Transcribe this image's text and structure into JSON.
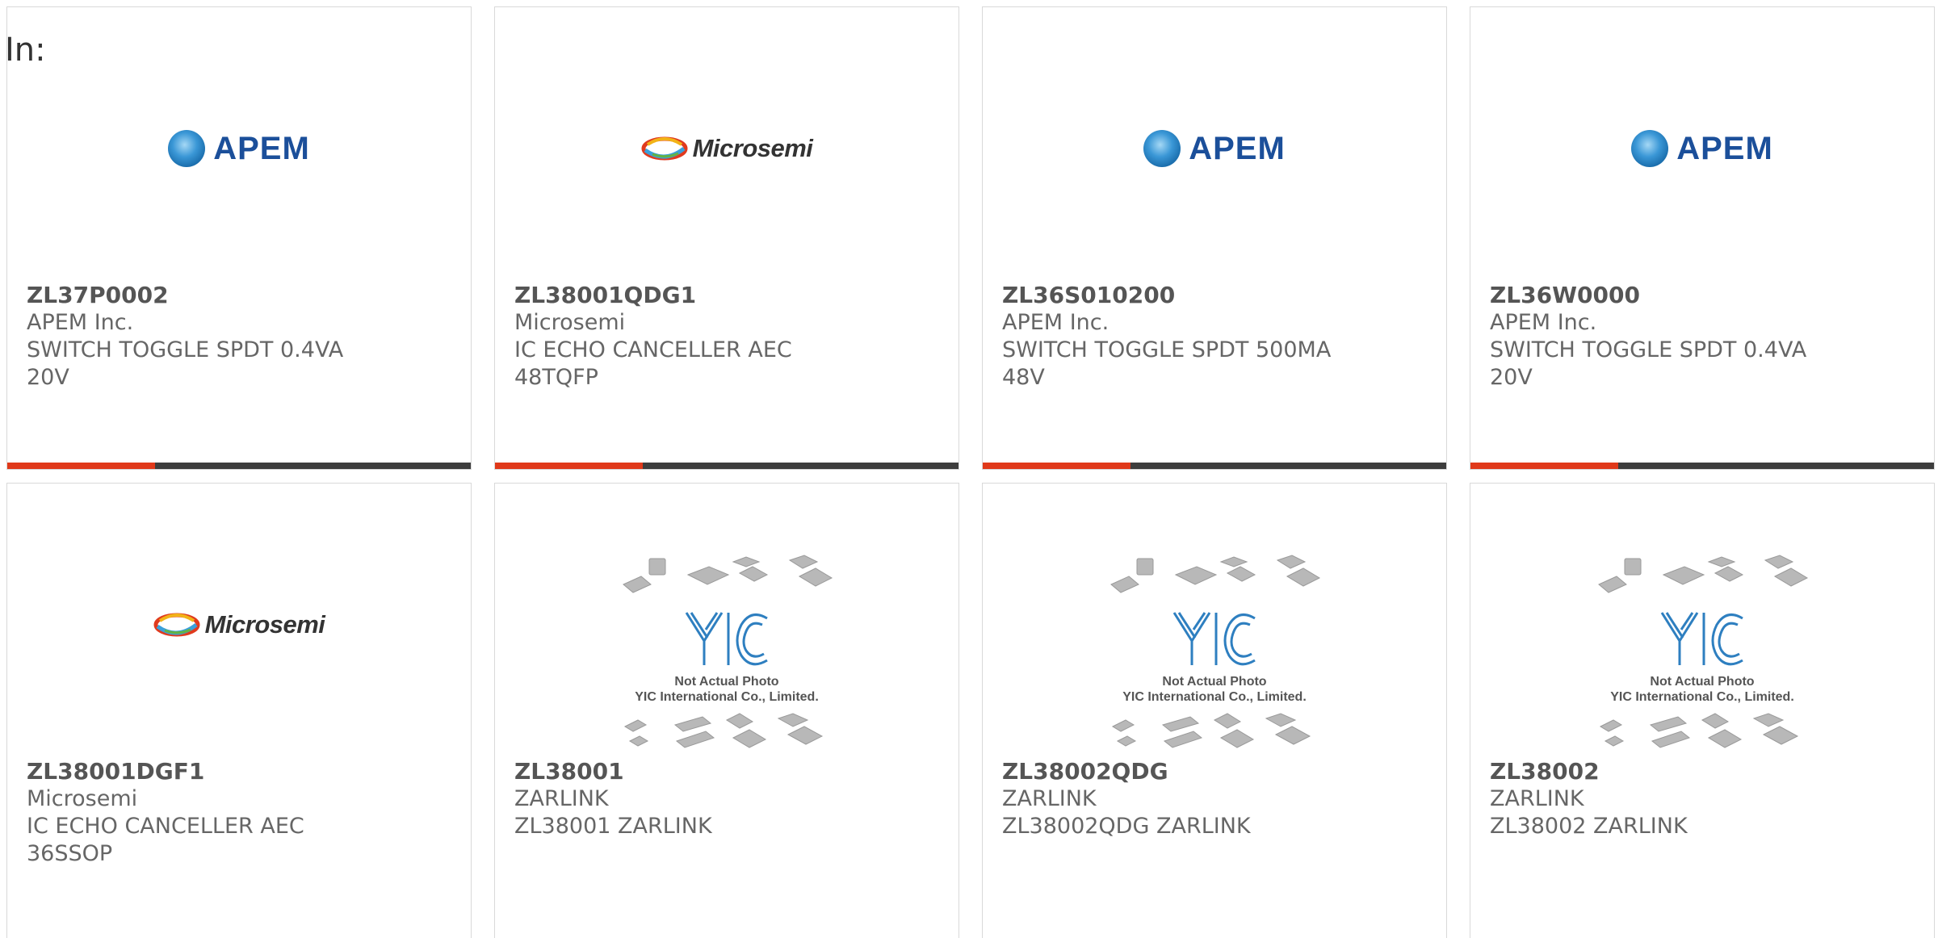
{
  "header": {
    "label": "In:"
  },
  "colors": {
    "accent": "#e0391a",
    "bar": "#3d3d3d",
    "apem_blue": "#1b4f9a"
  },
  "cards": [
    {
      "image": "apem-logo",
      "logo_text": "APEM",
      "part": "ZL37P0002",
      "maker": "APEM Inc.",
      "desc": "SWITCH TOGGLE SPDT 0.4VA 20V"
    },
    {
      "image": "microsemi-logo",
      "logo_text": "Microsemi",
      "part": "ZL38001QDG1",
      "maker": "Microsemi",
      "desc": "IC ECHO CANCELLER AEC 48TQFP"
    },
    {
      "image": "apem-logo",
      "logo_text": "APEM",
      "part": "ZL36S010200",
      "maker": "APEM Inc.",
      "desc": "SWITCH TOGGLE SPDT 500MA 48V"
    },
    {
      "image": "apem-logo",
      "logo_text": "APEM",
      "part": "ZL36W0000",
      "maker": "APEM Inc.",
      "desc": "SWITCH TOGGLE SPDT 0.4VA 20V"
    },
    {
      "image": "microsemi-logo",
      "logo_text": "Microsemi",
      "part": "ZL38001DGF1",
      "maker": "Microsemi",
      "desc": "IC ECHO CANCELLER AEC 36SSOP"
    },
    {
      "image": "yic-placeholder",
      "logo_text": "YIC",
      "caption_1": "Not Actual Photo",
      "caption_2": "YIC International Co., Limited.",
      "part": "ZL38001",
      "maker": "ZARLINK",
      "desc": "ZL38001 ZARLINK"
    },
    {
      "image": "yic-placeholder",
      "logo_text": "YIC",
      "caption_1": "Not Actual Photo",
      "caption_2": "YIC International Co., Limited.",
      "part": "ZL38002QDG",
      "maker": "ZARLINK",
      "desc": "ZL38002QDG ZARLINK"
    },
    {
      "image": "yic-placeholder",
      "logo_text": "YIC",
      "caption_1": "Not Actual Photo",
      "caption_2": "YIC International Co., Limited.",
      "part": "ZL38002",
      "maker": "ZARLINK",
      "desc": "ZL38002 ZARLINK"
    }
  ]
}
